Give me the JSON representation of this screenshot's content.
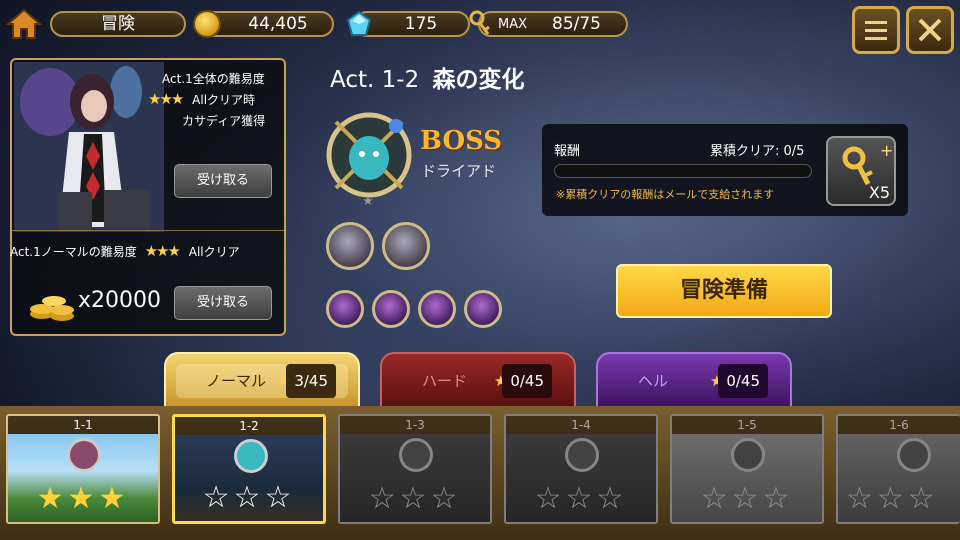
{
  "topbar": {
    "mode_label": "冒険",
    "gold": "44,405",
    "gems": "175",
    "key_max_label": "MAX",
    "keys": "85/75",
    "icons": [
      "home-icon",
      "gold-coin-icon",
      "gem-icon",
      "key-icon",
      "menu-icon",
      "close-icon"
    ]
  },
  "act_reward": {
    "hard_line1": "Act.1全体の難易度",
    "hard_line2": "Allクリア時",
    "hard_line3": "カサディア獲得",
    "hard_stars": "★★★",
    "hard_receive": "受け取る",
    "normal_line": "Act.1ノーマルの難易度",
    "normal_stars": "★★★",
    "normal_suffix": "Allクリア",
    "gold_amount": "x20000",
    "normal_receive": "受け取る"
  },
  "stage": {
    "act_label": "Act. 1-2",
    "name": "森の変化",
    "boss_label": "BOSS",
    "boss_name": "ドライアド"
  },
  "reward": {
    "title": "報酬",
    "progress_label": "累積クリア: 0/5",
    "progress": 0.0,
    "note": "※累積クリアの報酬はメールで支給されます",
    "item_count": "X5"
  },
  "prepare_button": "冒険準備",
  "difficulty_tabs": [
    {
      "label": "ノーマル",
      "star": "★",
      "count": "3/45",
      "color": "#e2b64a"
    },
    {
      "label": "ハード",
      "star": "★",
      "count": "0/45",
      "color": "#b03a3a"
    },
    {
      "label": "ヘル",
      "star": "★",
      "count": "0/45",
      "color": "#7a3ab0"
    }
  ],
  "stages": [
    {
      "id": "1-1",
      "stars": "★★★",
      "earned": 3
    },
    {
      "id": "1-2",
      "stars": "☆☆☆",
      "earned": 0
    },
    {
      "id": "1-3",
      "stars": "☆☆☆",
      "earned": 0
    },
    {
      "id": "1-4",
      "stars": "☆☆☆",
      "earned": 0
    },
    {
      "id": "1-5",
      "stars": "☆☆☆",
      "earned": 0
    },
    {
      "id": "1-6",
      "stars": "☆☆☆",
      "earned": 0
    }
  ]
}
